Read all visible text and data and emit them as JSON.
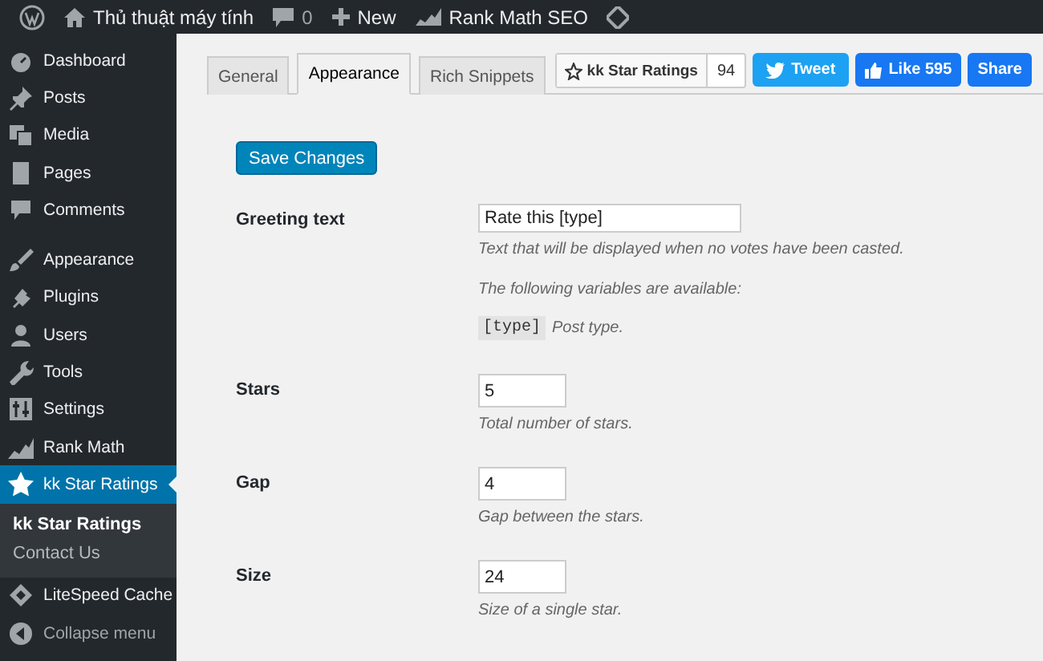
{
  "admin_bar": [
    {
      "kind": "logo"
    },
    {
      "kind": "site",
      "label": "Thủ thuật máy tính"
    },
    {
      "kind": "comments",
      "label": "0"
    },
    {
      "kind": "new",
      "label": "New"
    },
    {
      "kind": "rankmath",
      "label": "Rank Math SEO"
    },
    {
      "kind": "diamond"
    }
  ],
  "sidebar": {
    "items": [
      {
        "label": "Dashboard",
        "selected": false
      },
      {
        "label": "Posts",
        "selected": false
      },
      {
        "label": "Media",
        "selected": false
      },
      {
        "label": "Pages",
        "selected": false
      },
      {
        "label": "Comments",
        "selected": false
      },
      {
        "label": "Appearance",
        "selected": false
      },
      {
        "label": "Plugins",
        "selected": false
      },
      {
        "label": "Users",
        "selected": false
      },
      {
        "label": "Tools",
        "selected": false
      },
      {
        "label": "Settings",
        "selected": false
      },
      {
        "label": "Rank Math",
        "selected": false
      },
      {
        "label": "kk Star Ratings",
        "selected": true,
        "children": [
          {
            "label": "kk Star Ratings",
            "selected": true
          },
          {
            "label": "Contact Us",
            "selected": false
          }
        ]
      },
      {
        "label": "LiteSpeed Cache",
        "selected": false
      },
      {
        "label": "Collapse menu",
        "selected": false
      }
    ]
  },
  "tabs": [
    {
      "label": "General",
      "selected": false
    },
    {
      "label": "Appearance",
      "selected": true
    },
    {
      "label": "Rich Snippets",
      "selected": false
    }
  ],
  "social": {
    "star_label": "kk Star Ratings",
    "star_count": "94",
    "tweet": "Tweet",
    "like": "Like 595",
    "share": "Share"
  },
  "save_button": "Save Changes",
  "fields": [
    {
      "label": "Greeting text",
      "value": "Rate this [type]",
      "kind": "wide",
      "description": "Text that will be displayed when no votes have been casted.",
      "note": "The following variables are available:",
      "variables": [
        {
          "code": "[type]",
          "text": "Post type."
        }
      ]
    },
    {
      "label": "Stars",
      "value": "5",
      "kind": "short",
      "description": "Total number of stars."
    },
    {
      "label": "Gap",
      "value": "4",
      "kind": "short",
      "description": "Gap between the stars."
    },
    {
      "label": "Size",
      "value": "24",
      "kind": "short",
      "description": "Size of a single star."
    }
  ]
}
